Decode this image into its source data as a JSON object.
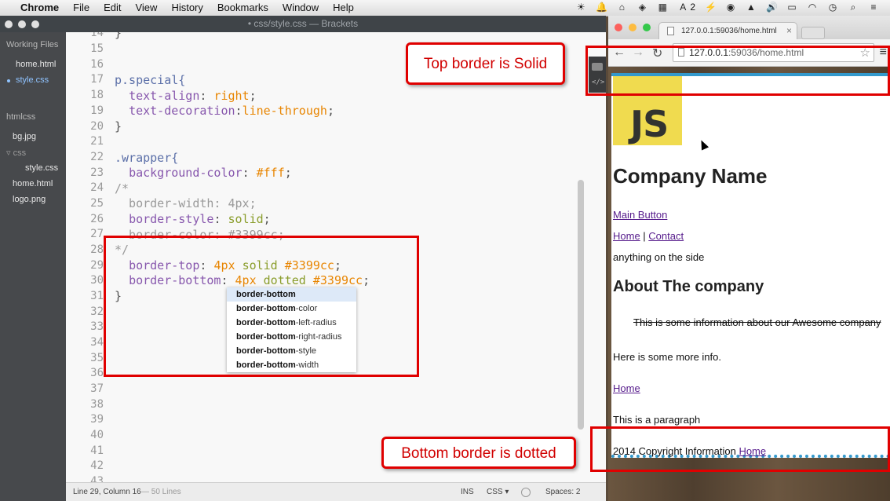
{
  "menubar": {
    "app": "Chrome",
    "items": [
      "File",
      "Edit",
      "View",
      "History",
      "Bookmarks",
      "Window",
      "Help"
    ],
    "status_text": "2"
  },
  "brackets": {
    "title": "• css/style.css — Brackets",
    "working_files_header": "Working Files",
    "working_files": [
      "home.html",
      "style.css"
    ],
    "project_header": "htmlcss",
    "tree": [
      "bg.jpg",
      "css",
      "style.css",
      "home.html",
      "logo.png"
    ],
    "lines": [
      {
        "n": "14",
        "code": "}"
      },
      {
        "n": "15",
        "code": ""
      },
      {
        "n": "16",
        "code": "p.special{"
      },
      {
        "n": "17",
        "code": "  text-align: right;"
      },
      {
        "n": "18",
        "code": "  text-decoration:line-through;"
      },
      {
        "n": "19",
        "code": "}"
      },
      {
        "n": "20",
        "code": ""
      },
      {
        "n": "21",
        "code": ".wrapper{"
      },
      {
        "n": "22",
        "code": "  background-color: #fff;"
      },
      {
        "n": "23",
        "code": "/*"
      },
      {
        "n": "24",
        "code": "  border-width: 4px;"
      },
      {
        "n": "25",
        "code": "  border-style: solid;"
      },
      {
        "n": "26",
        "code": "  border-color: #3399cc;"
      },
      {
        "n": "27",
        "code": "*/"
      },
      {
        "n": "28",
        "code": "  border-top: 4px solid #3399cc;"
      },
      {
        "n": "29",
        "code": "  border-bottom: 4px dotted #3399cc;"
      },
      {
        "n": "30",
        "code": "}"
      },
      {
        "n": "31",
        "code": ""
      },
      {
        "n": "32",
        "code": ""
      },
      {
        "n": "33",
        "code": ""
      },
      {
        "n": "34",
        "code": ""
      },
      {
        "n": "35",
        "code": ""
      },
      {
        "n": "36",
        "code": ""
      },
      {
        "n": "37",
        "code": ""
      },
      {
        "n": "38",
        "code": ""
      },
      {
        "n": "39",
        "code": ""
      },
      {
        "n": "40",
        "code": ""
      },
      {
        "n": "41",
        "code": ""
      },
      {
        "n": "42",
        "code": ""
      },
      {
        "n": "43",
        "code": ""
      }
    ],
    "hints": [
      {
        "match": "border-bottom",
        "rest": ""
      },
      {
        "match": "border-bottom",
        "rest": "-color"
      },
      {
        "match": "border-bottom",
        "rest": "-left-radius"
      },
      {
        "match": "border-bottom",
        "rest": "-right-radius"
      },
      {
        "match": "border-bottom",
        "rest": "-style"
      },
      {
        "match": "border-bottom",
        "rest": "-width"
      }
    ],
    "status": {
      "position": "Line 29, Column 16",
      "lines": "— 50 Lines",
      "mode": "INS",
      "language": "CSS ▾",
      "spaces": "Spaces: 2"
    }
  },
  "chrome": {
    "tab_title": "127.0.0.1:59036/home.html",
    "url_host": "127.0.0.1",
    "url_rest": ":59036/home.html",
    "page": {
      "logo_text": "JS",
      "company_name": "Company Name",
      "main_button": "Main Button",
      "nav_home": "Home",
      "nav_sep": " | ",
      "nav_contact": "Contact",
      "side": "anything on the side",
      "about_heading": "About The company",
      "special": "This is some information about our Awesome company",
      "more_info": "Here is some more info.",
      "home_link": "Home",
      "paragraph": "This is a paragraph",
      "copyright": "2014 Copyright Information ",
      "copyright_link": "Home"
    }
  },
  "annotations": {
    "top_callout": "Top border is Solid",
    "bottom_callout": "Bottom border is dotted"
  },
  "colors": {
    "border_blue": "#3399cc",
    "annotation_red": "#e00000",
    "js_yellow": "#f0db4f"
  }
}
